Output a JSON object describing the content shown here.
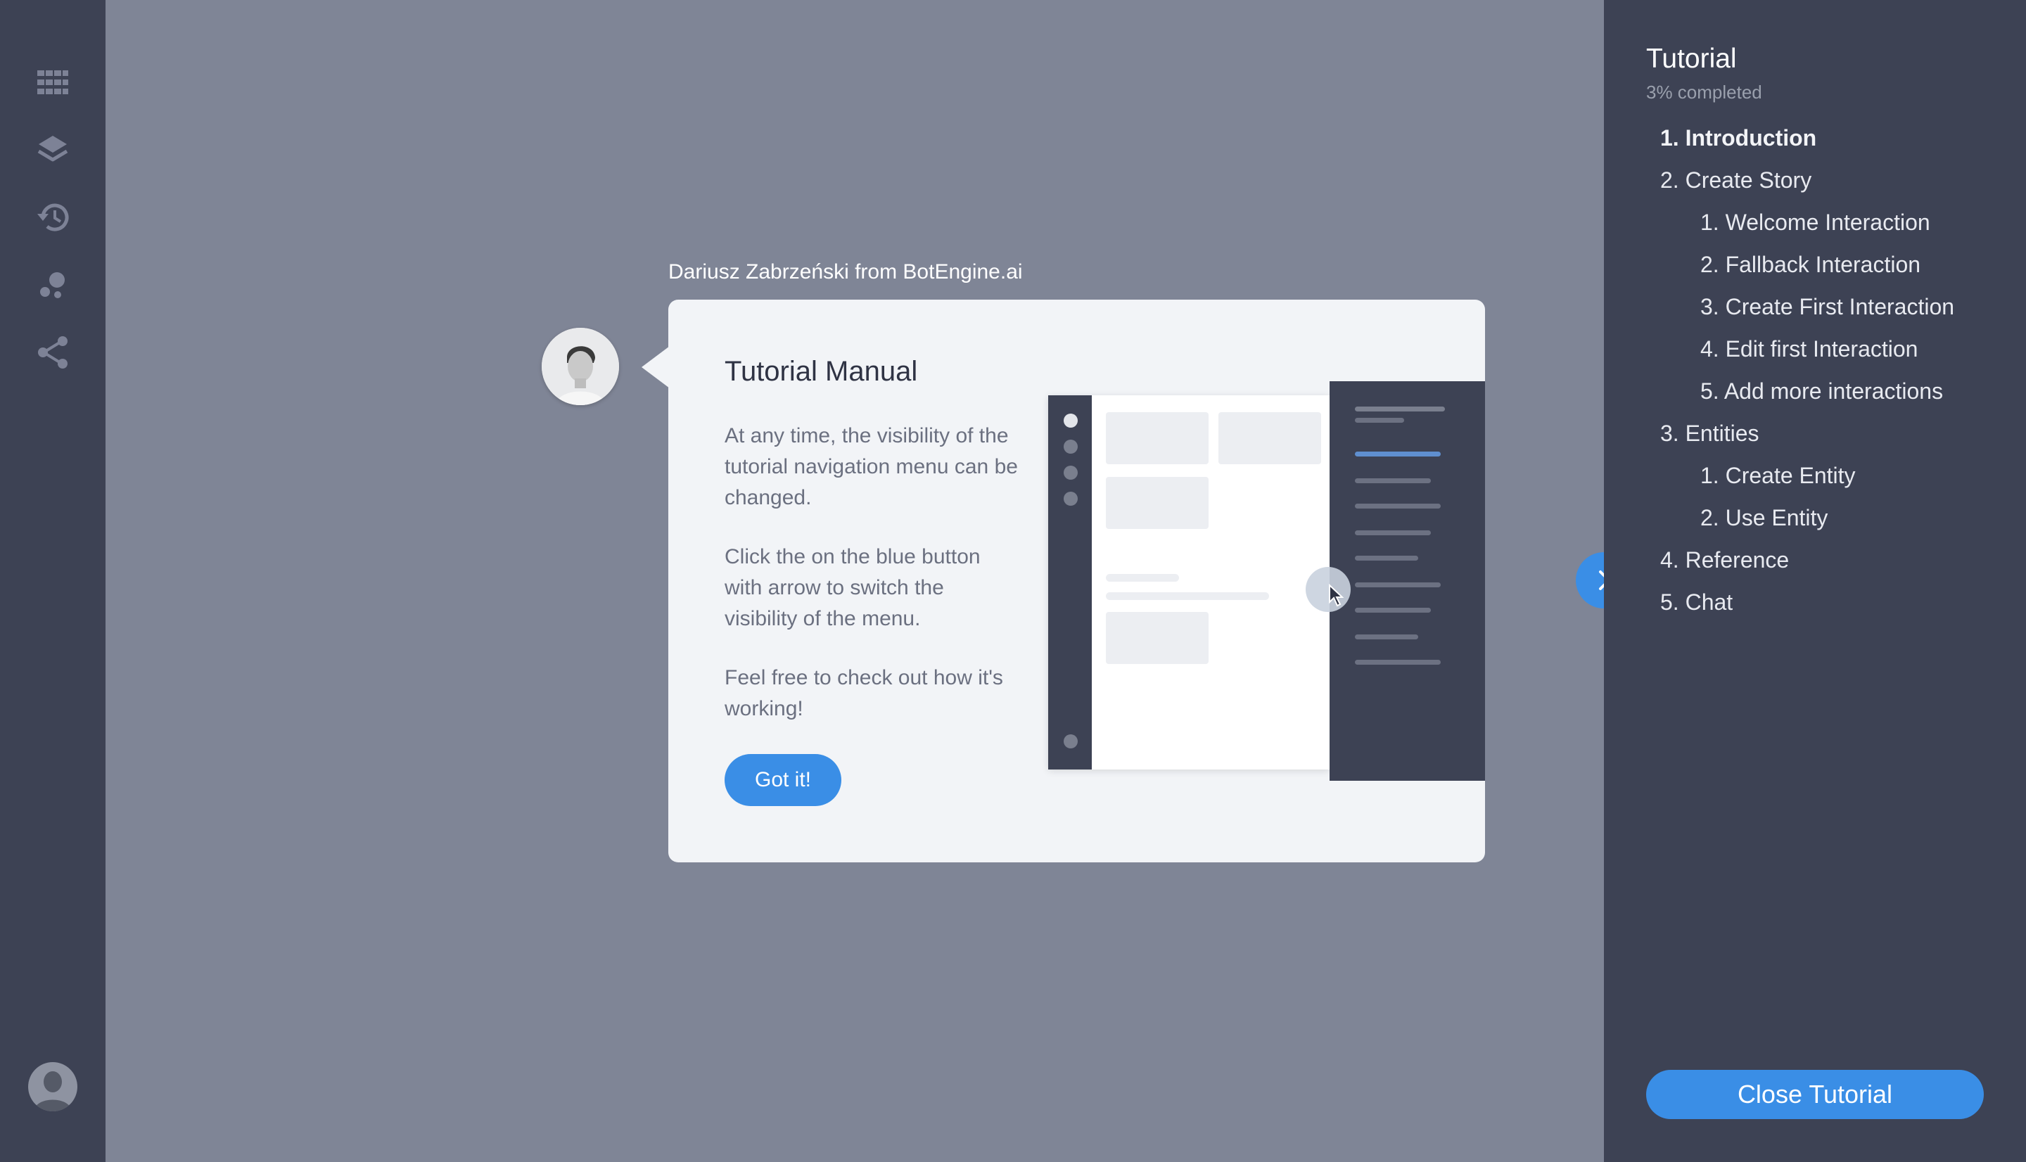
{
  "rail": {
    "icons": [
      "grid-icon",
      "layers-icon",
      "history-icon",
      "bubbles-icon",
      "share-icon"
    ],
    "avatar_icon": "user-avatar-icon"
  },
  "tutorial_panel": {
    "title": "Tutorial",
    "progress": "3% completed",
    "items": [
      {
        "label": "1. Introduction",
        "level": 0,
        "active": true
      },
      {
        "label": "2. Create Story",
        "level": 0,
        "active": false
      },
      {
        "label": "1. Welcome Interaction",
        "level": 1,
        "active": false
      },
      {
        "label": "2. Fallback Interaction",
        "level": 1,
        "active": false
      },
      {
        "label": "3. Create First Interaction",
        "level": 1,
        "active": false
      },
      {
        "label": "4. Edit first Interaction",
        "level": 1,
        "active": false
      },
      {
        "label": "5. Add more interactions",
        "level": 1,
        "active": false
      },
      {
        "label": "3. Entities",
        "level": 0,
        "active": false
      },
      {
        "label": "1. Create Entity",
        "level": 1,
        "active": false
      },
      {
        "label": "2. Use Entity",
        "level": 1,
        "active": false
      },
      {
        "label": "4. Reference",
        "level": 0,
        "active": false
      },
      {
        "label": "5. Chat",
        "level": 0,
        "active": false
      }
    ],
    "close_label": "Close Tutorial",
    "toggle_icon": "chevron-right-icon"
  },
  "message": {
    "sender": "Dariusz Zabrzeński from BotEngine.ai",
    "card_title": "Tutorial Manual",
    "paragraphs": [
      "At any time, the visibility of the tutorial navigation menu can be changed.",
      "Click the on the blue button with arrow to switch the visibility of the menu.",
      "Feel free to check out how it's working!"
    ],
    "button_label": "Got it!"
  },
  "colors": {
    "background": "#7f8596",
    "sidebar": "#3d4254",
    "accent": "#3a8ee6",
    "card": "#f2f4f7"
  }
}
